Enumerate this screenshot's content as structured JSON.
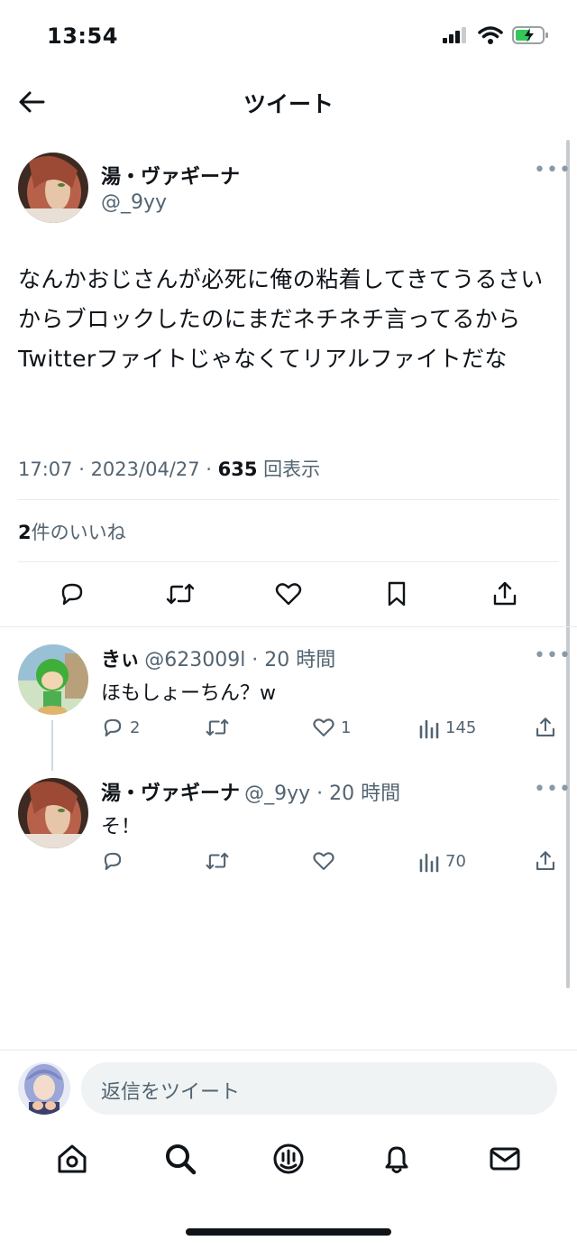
{
  "status_bar": {
    "time": "13:54"
  },
  "header": {
    "title": "ツイート"
  },
  "tweet": {
    "display_name": "湯・ヴァギーナ",
    "handle": "@_9yy",
    "text": "なんかおじさんが必死に俺の粘着してきてうるさいからブロックしたのにまだネチネチ言ってるから Twitterファイトじゃなくてリアルファイトだな",
    "time": "17:07",
    "date": "2023/04/27",
    "views": "635",
    "views_label": "回表示",
    "likes_count": "2",
    "likes_label": "件のいいね",
    "separator": " · "
  },
  "replies": [
    {
      "display_name": "きぃ",
      "handle_time": "@623009l · 20 時間",
      "text": "ほもしょーちん？w",
      "replies": "2",
      "retweets": "",
      "likes": "1",
      "views": "145"
    },
    {
      "display_name": "湯・ヴァギーナ",
      "handle_time": "@_9yy · 20 時間",
      "text": "そ！",
      "replies": "",
      "retweets": "",
      "likes": "",
      "views": "70"
    }
  ],
  "compose": {
    "placeholder": "返信をツイート"
  },
  "colors": {
    "text": "#0f1419",
    "muted": "#536471",
    "divider": "#e6ecf0",
    "compose_bg": "#eff3f4"
  }
}
